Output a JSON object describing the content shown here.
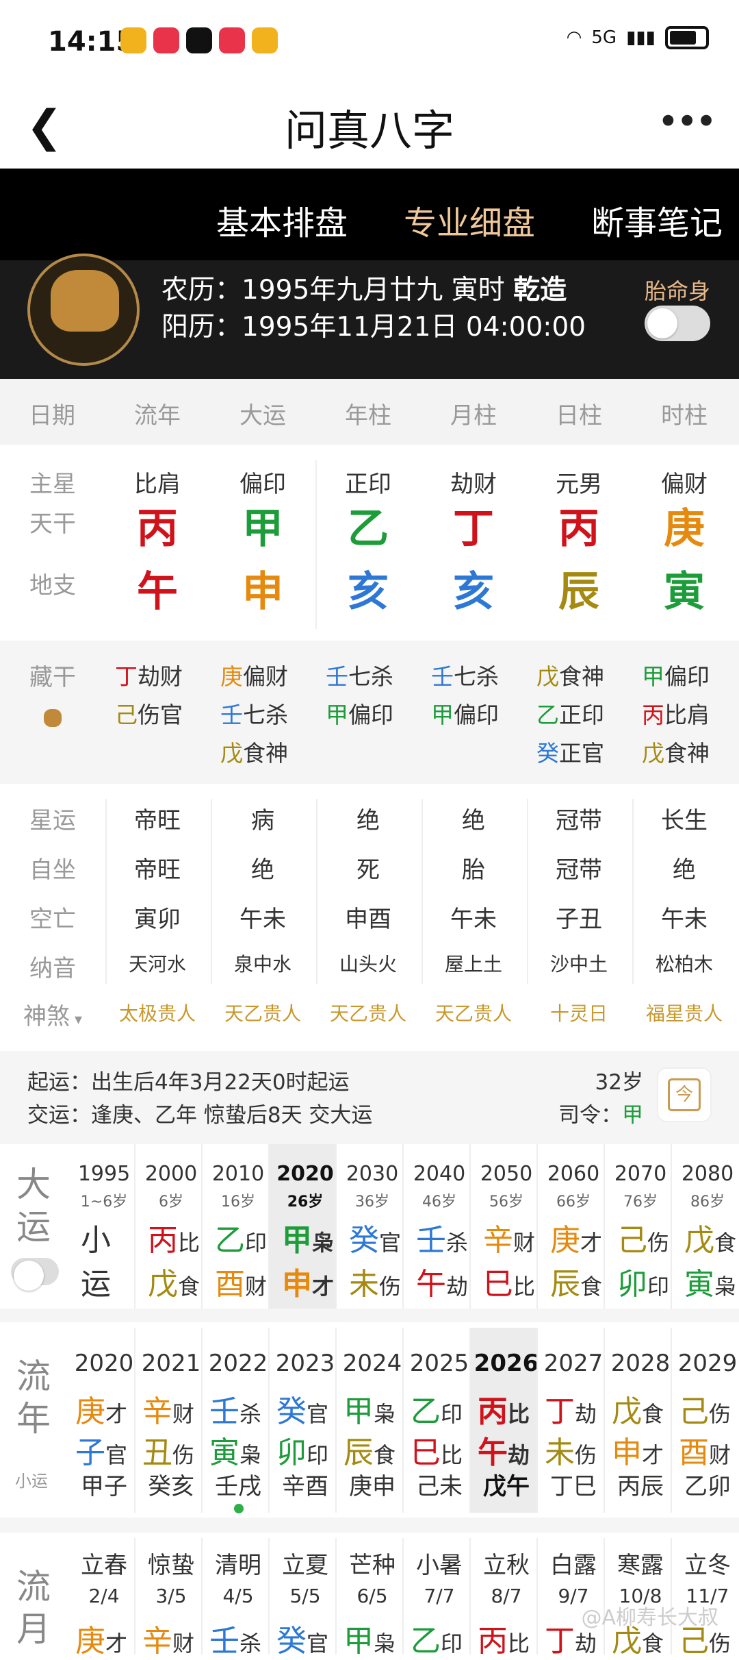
{
  "status": {
    "time": "14:15",
    "net": "5G"
  },
  "titlebar": {
    "title": "问真八字"
  },
  "tabs": [
    "基本排盘",
    "专业细盘",
    "断事笔记"
  ],
  "header": {
    "lunar_label": "农历：",
    "lunar": "1995年九月廿九 寅时",
    "gender": "乾造",
    "solar_label": "阳历：",
    "solar": "1995年11月21日 04:00:00",
    "taiming": "胎命身"
  },
  "cols": [
    "日期",
    "流年",
    "大运",
    "年柱",
    "月柱",
    "日柱",
    "时柱"
  ],
  "main_labels": [
    "主星",
    "天干",
    "地支"
  ],
  "zhuxing": [
    "比肩",
    "偏印",
    "正印",
    "劫财",
    "元男",
    "偏财"
  ],
  "tiangan": [
    "丙",
    "甲",
    "乙",
    "丁",
    "丙",
    "庚"
  ],
  "dizhi": [
    "午",
    "申",
    "亥",
    "亥",
    "辰",
    "寅"
  ],
  "colors": {
    "fire": "#d0121b",
    "wood": "#1d9c3a",
    "water": "#2d78d5",
    "metal": "#e58a0e",
    "earth": "#a48a10"
  },
  "canggan_label": "藏干",
  "canggan": [
    [
      [
        "丁",
        "劫财",
        "fire"
      ],
      [
        "己",
        "伤官",
        "earth"
      ]
    ],
    [
      [
        "庚",
        "偏财",
        "metal"
      ],
      [
        "壬",
        "七杀",
        "water"
      ],
      [
        "戊",
        "食神",
        "earth"
      ]
    ],
    [
      [
        "壬",
        "七杀",
        "water"
      ],
      [
        "甲",
        "偏印",
        "wood"
      ]
    ],
    [
      [
        "壬",
        "七杀",
        "water"
      ],
      [
        "甲",
        "偏印",
        "wood"
      ]
    ],
    [
      [
        "戊",
        "食神",
        "earth"
      ],
      [
        "乙",
        "正印",
        "wood"
      ],
      [
        "癸",
        "正官",
        "water"
      ]
    ],
    [
      [
        "甲",
        "偏印",
        "wood"
      ],
      [
        "丙",
        "比肩",
        "fire"
      ],
      [
        "戊",
        "食神",
        "earth"
      ]
    ]
  ],
  "rows3_labels": [
    "星运",
    "自坐",
    "空亡",
    "纳音",
    "神煞"
  ],
  "xingyun": [
    "帝旺",
    "病",
    "绝",
    "绝",
    "冠带",
    "长生"
  ],
  "zizuo": [
    "帝旺",
    "绝",
    "死",
    "胎",
    "冠带",
    "绝"
  ],
  "kongwang": [
    "寅卯",
    "午未",
    "申酉",
    "午未",
    "子丑",
    "午未"
  ],
  "nayin": [
    "天河水",
    "泉中水",
    "山头火",
    "屋上土",
    "沙中土",
    "松柏木"
  ],
  "shensha": [
    "太极贵人",
    "天乙贵人",
    "天乙贵人",
    "天乙贵人",
    "十灵日",
    "福星贵人"
  ],
  "qiyun": {
    "line1_label": "起运：",
    "line1": "出生后4年3月22天0时起运",
    "line2_label": "交运：",
    "line2": "逢庚、乙年 惊蛰后8天 交大运",
    "age": "32岁",
    "siling_label": "司令：",
    "siling": "甲"
  },
  "dayun_label": [
    "大",
    "运"
  ],
  "dayun": [
    {
      "year": "1995",
      "age": "1~6岁",
      "g": "小",
      "gs": "",
      "gc": "#333",
      "z": "运",
      "zs": "",
      "zc": "#333"
    },
    {
      "year": "2000",
      "age": "6岁",
      "g": "丙",
      "gs": "比",
      "gc": "#d0121b",
      "z": "戊",
      "zs": "食",
      "zc": "#a48a10"
    },
    {
      "year": "2010",
      "age": "16岁",
      "g": "乙",
      "gs": "印",
      "gc": "#1d9c3a",
      "z": "酉",
      "zs": "财",
      "zc": "#e58a0e"
    },
    {
      "year": "2020",
      "age": "26岁",
      "g": "甲",
      "gs": "枭",
      "gc": "#1d9c3a",
      "z": "申",
      "zs": "才",
      "zc": "#e58a0e"
    },
    {
      "year": "2030",
      "age": "36岁",
      "g": "癸",
      "gs": "官",
      "gc": "#2d78d5",
      "z": "未",
      "zs": "伤",
      "zc": "#a48a10"
    },
    {
      "year": "2040",
      "age": "46岁",
      "g": "壬",
      "gs": "杀",
      "gc": "#2d78d5",
      "z": "午",
      "zs": "劫",
      "zc": "#d0121b"
    },
    {
      "year": "2050",
      "age": "56岁",
      "g": "辛",
      "gs": "财",
      "gc": "#e58a0e",
      "z": "巳",
      "zs": "比",
      "zc": "#d0121b"
    },
    {
      "year": "2060",
      "age": "66岁",
      "g": "庚",
      "gs": "才",
      "gc": "#e58a0e",
      "z": "辰",
      "zs": "食",
      "zc": "#a48a10"
    },
    {
      "year": "2070",
      "age": "76岁",
      "g": "己",
      "gs": "伤",
      "gc": "#a48a10",
      "z": "卯",
      "zs": "印",
      "zc": "#1d9c3a"
    },
    {
      "year": "2080",
      "age": "86岁",
      "g": "戊",
      "gs": "食",
      "gc": "#a48a10",
      "z": "寅",
      "zs": "枭",
      "zc": "#1d9c3a"
    }
  ],
  "liunian_label": [
    "流",
    "年"
  ],
  "liunian_sub": "小运",
  "liunian": [
    {
      "year": "2020",
      "g": "庚",
      "gs": "才",
      "gc": "#e58a0e",
      "z": "子",
      "zs": "官",
      "zc": "#2d78d5",
      "x": "甲子"
    },
    {
      "year": "2021",
      "g": "辛",
      "gs": "财",
      "gc": "#e58a0e",
      "z": "丑",
      "zs": "伤",
      "zc": "#a48a10",
      "x": "癸亥"
    },
    {
      "year": "2022",
      "g": "壬",
      "gs": "杀",
      "gc": "#2d78d5",
      "z": "寅",
      "zs": "枭",
      "zc": "#1d9c3a",
      "x": "壬戌"
    },
    {
      "year": "2023",
      "g": "癸",
      "gs": "官",
      "gc": "#2d78d5",
      "z": "卯",
      "zs": "印",
      "zc": "#1d9c3a",
      "x": "辛酉"
    },
    {
      "year": "2024",
      "g": "甲",
      "gs": "枭",
      "gc": "#1d9c3a",
      "z": "辰",
      "zs": "食",
      "zc": "#a48a10",
      "x": "庚申"
    },
    {
      "year": "2025",
      "g": "乙",
      "gs": "印",
      "gc": "#1d9c3a",
      "z": "巳",
      "zs": "比",
      "zc": "#d0121b",
      "x": "己未"
    },
    {
      "year": "2026",
      "g": "丙",
      "gs": "比",
      "gc": "#d0121b",
      "z": "午",
      "zs": "劫",
      "zc": "#d0121b",
      "x": "戊午"
    },
    {
      "year": "2027",
      "g": "丁",
      "gs": "劫",
      "gc": "#d0121b",
      "z": "未",
      "zs": "伤",
      "zc": "#a48a10",
      "x": "丁巳"
    },
    {
      "year": "2028",
      "g": "戊",
      "gs": "食",
      "gc": "#a48a10",
      "z": "申",
      "zs": "才",
      "zc": "#e58a0e",
      "x": "丙辰"
    },
    {
      "year": "2029",
      "g": "己",
      "gs": "伤",
      "gc": "#a48a10",
      "z": "酉",
      "zs": "财",
      "zc": "#e58a0e",
      "x": "乙卯"
    }
  ],
  "liuyue_label": [
    "流",
    "月"
  ],
  "liuyue": [
    {
      "jq": "立春",
      "d": "2/4",
      "g": "庚",
      "gs": "才",
      "gc": "#e58a0e"
    },
    {
      "jq": "惊蛰",
      "d": "3/5",
      "g": "辛",
      "gs": "财",
      "gc": "#e58a0e"
    },
    {
      "jq": "清明",
      "d": "4/5",
      "g": "壬",
      "gs": "杀",
      "gc": "#2d78d5"
    },
    {
      "jq": "立夏",
      "d": "5/5",
      "g": "癸",
      "gs": "官",
      "gc": "#2d78d5"
    },
    {
      "jq": "芒种",
      "d": "6/5",
      "g": "甲",
      "gs": "枭",
      "gc": "#1d9c3a"
    },
    {
      "jq": "小暑",
      "d": "7/7",
      "g": "乙",
      "gs": "印",
      "gc": "#1d9c3a"
    },
    {
      "jq": "立秋",
      "d": "8/7",
      "g": "丙",
      "gs": "比",
      "gc": "#d0121b"
    },
    {
      "jq": "白露",
      "d": "9/7",
      "g": "丁",
      "gs": "劫",
      "gc": "#d0121b"
    },
    {
      "jq": "寒露",
      "d": "10/8",
      "g": "戊",
      "gs": "食",
      "gc": "#a48a10"
    },
    {
      "jq": "立冬",
      "d": "11/7",
      "g": "己",
      "gs": "伤",
      "gc": "#a48a10"
    }
  ],
  "watermark": "@A柳寿长大叔"
}
